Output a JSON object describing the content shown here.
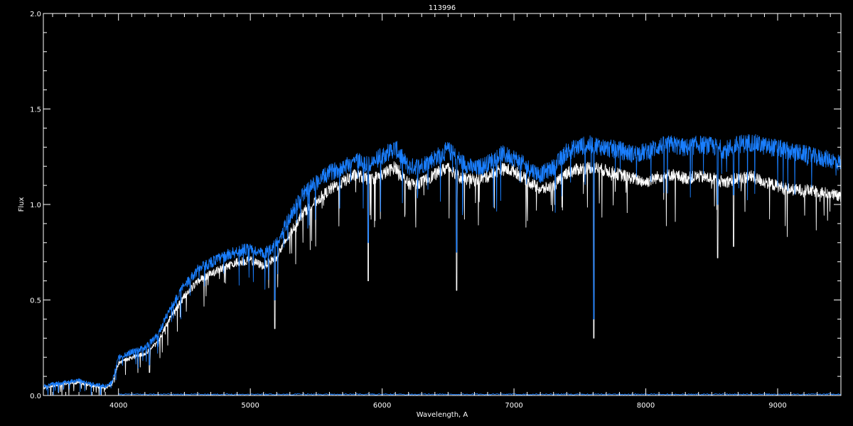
{
  "chart_data": {
    "type": "line",
    "title": "113996",
    "xlabel": "Wavelength, A",
    "ylabel": "Flux",
    "xlim": [
      3430,
      9480
    ],
    "ylim": [
      0.0,
      2.0
    ],
    "grid": false,
    "background": "#000000",
    "axis_color": "#ffffff",
    "xticks": [
      4000,
      5000,
      6000,
      7000,
      8000,
      9000
    ],
    "yticks": [
      0.0,
      0.5,
      1.0,
      1.5,
      2.0
    ],
    "ytick_labels": [
      "0.0",
      "0.5",
      "1.0",
      "1.5",
      "2.0"
    ],
    "series": [
      {
        "color": "#ffffff",
        "noise": 0.045,
        "points": [
          [
            3430,
            0.04
          ],
          [
            3500,
            0.05
          ],
          [
            3600,
            0.06
          ],
          [
            3700,
            0.07
          ],
          [
            3800,
            0.05
          ],
          [
            3900,
            0.04
          ],
          [
            3950,
            0.06
          ],
          [
            4000,
            0.17
          ],
          [
            4100,
            0.2
          ],
          [
            4200,
            0.22
          ],
          [
            4300,
            0.28
          ],
          [
            4400,
            0.42
          ],
          [
            4500,
            0.52
          ],
          [
            4600,
            0.6
          ],
          [
            4700,
            0.64
          ],
          [
            4800,
            0.67
          ],
          [
            4900,
            0.7
          ],
          [
            5000,
            0.71
          ],
          [
            5100,
            0.68
          ],
          [
            5200,
            0.73
          ],
          [
            5300,
            0.85
          ],
          [
            5400,
            0.96
          ],
          [
            5500,
            1.02
          ],
          [
            5600,
            1.08
          ],
          [
            5700,
            1.12
          ],
          [
            5800,
            1.16
          ],
          [
            5900,
            1.13
          ],
          [
            6000,
            1.16
          ],
          [
            6100,
            1.2
          ],
          [
            6200,
            1.11
          ],
          [
            6300,
            1.12
          ],
          [
            6400,
            1.16
          ],
          [
            6500,
            1.2
          ],
          [
            6600,
            1.14
          ],
          [
            6700,
            1.13
          ],
          [
            6800,
            1.15
          ],
          [
            6900,
            1.19
          ],
          [
            7000,
            1.18
          ],
          [
            7100,
            1.13
          ],
          [
            7200,
            1.08
          ],
          [
            7300,
            1.1
          ],
          [
            7400,
            1.17
          ],
          [
            7500,
            1.19
          ],
          [
            7600,
            1.2
          ],
          [
            7700,
            1.18
          ],
          [
            7800,
            1.16
          ],
          [
            7900,
            1.14
          ],
          [
            8000,
            1.12
          ],
          [
            8100,
            1.15
          ],
          [
            8200,
            1.16
          ],
          [
            8300,
            1.14
          ],
          [
            8400,
            1.15
          ],
          [
            8500,
            1.14
          ],
          [
            8600,
            1.12
          ],
          [
            8700,
            1.14
          ],
          [
            8800,
            1.15
          ],
          [
            8900,
            1.12
          ],
          [
            9000,
            1.1
          ],
          [
            9100,
            1.08
          ],
          [
            9200,
            1.08
          ],
          [
            9300,
            1.07
          ],
          [
            9400,
            1.06
          ],
          [
            9480,
            1.04
          ]
        ],
        "dips": [
          [
            4235,
            0.12
          ],
          [
            5185,
            0.35
          ],
          [
            5895,
            0.6
          ],
          [
            6565,
            0.55
          ],
          [
            7605,
            0.3
          ],
          [
            8545,
            0.72
          ],
          [
            8665,
            0.78
          ]
        ]
      },
      {
        "color": "#1a7fff",
        "noise": 0.06,
        "points": [
          [
            3430,
            0.05
          ],
          [
            3500,
            0.06
          ],
          [
            3600,
            0.07
          ],
          [
            3700,
            0.08
          ],
          [
            3800,
            0.06
          ],
          [
            3900,
            0.05
          ],
          [
            3950,
            0.07
          ],
          [
            4000,
            0.2
          ],
          [
            4100,
            0.23
          ],
          [
            4200,
            0.25
          ],
          [
            4300,
            0.32
          ],
          [
            4400,
            0.47
          ],
          [
            4500,
            0.58
          ],
          [
            4600,
            0.66
          ],
          [
            4700,
            0.7
          ],
          [
            4800,
            0.73
          ],
          [
            4900,
            0.76
          ],
          [
            5000,
            0.77
          ],
          [
            5100,
            0.74
          ],
          [
            5200,
            0.8
          ],
          [
            5300,
            0.94
          ],
          [
            5400,
            1.06
          ],
          [
            5500,
            1.12
          ],
          [
            5600,
            1.17
          ],
          [
            5700,
            1.2
          ],
          [
            5800,
            1.24
          ],
          [
            5900,
            1.21
          ],
          [
            6000,
            1.26
          ],
          [
            6100,
            1.3
          ],
          [
            6200,
            1.2
          ],
          [
            6300,
            1.21
          ],
          [
            6400,
            1.25
          ],
          [
            6500,
            1.29
          ],
          [
            6600,
            1.23
          ],
          [
            6700,
            1.19
          ],
          [
            6800,
            1.22
          ],
          [
            6900,
            1.27
          ],
          [
            7000,
            1.25
          ],
          [
            7100,
            1.2
          ],
          [
            7200,
            1.16
          ],
          [
            7300,
            1.2
          ],
          [
            7400,
            1.28
          ],
          [
            7500,
            1.31
          ],
          [
            7600,
            1.32
          ],
          [
            7700,
            1.3
          ],
          [
            7800,
            1.29
          ],
          [
            7900,
            1.27
          ],
          [
            8000,
            1.28
          ],
          [
            8100,
            1.31
          ],
          [
            8200,
            1.32
          ],
          [
            8300,
            1.3
          ],
          [
            8400,
            1.32
          ],
          [
            8500,
            1.31
          ],
          [
            8600,
            1.29
          ],
          [
            8700,
            1.32
          ],
          [
            8800,
            1.33
          ],
          [
            8900,
            1.31
          ],
          [
            9000,
            1.3
          ],
          [
            9100,
            1.28
          ],
          [
            9200,
            1.27
          ],
          [
            9300,
            1.25
          ],
          [
            9400,
            1.24
          ],
          [
            9480,
            1.22
          ]
        ],
        "dips": [
          [
            4235,
            0.16
          ],
          [
            5185,
            0.5
          ],
          [
            5895,
            0.8
          ],
          [
            6565,
            0.75
          ],
          [
            7605,
            0.4
          ],
          [
            8545,
            1.0
          ],
          [
            8665,
            1.05
          ]
        ]
      }
    ]
  }
}
